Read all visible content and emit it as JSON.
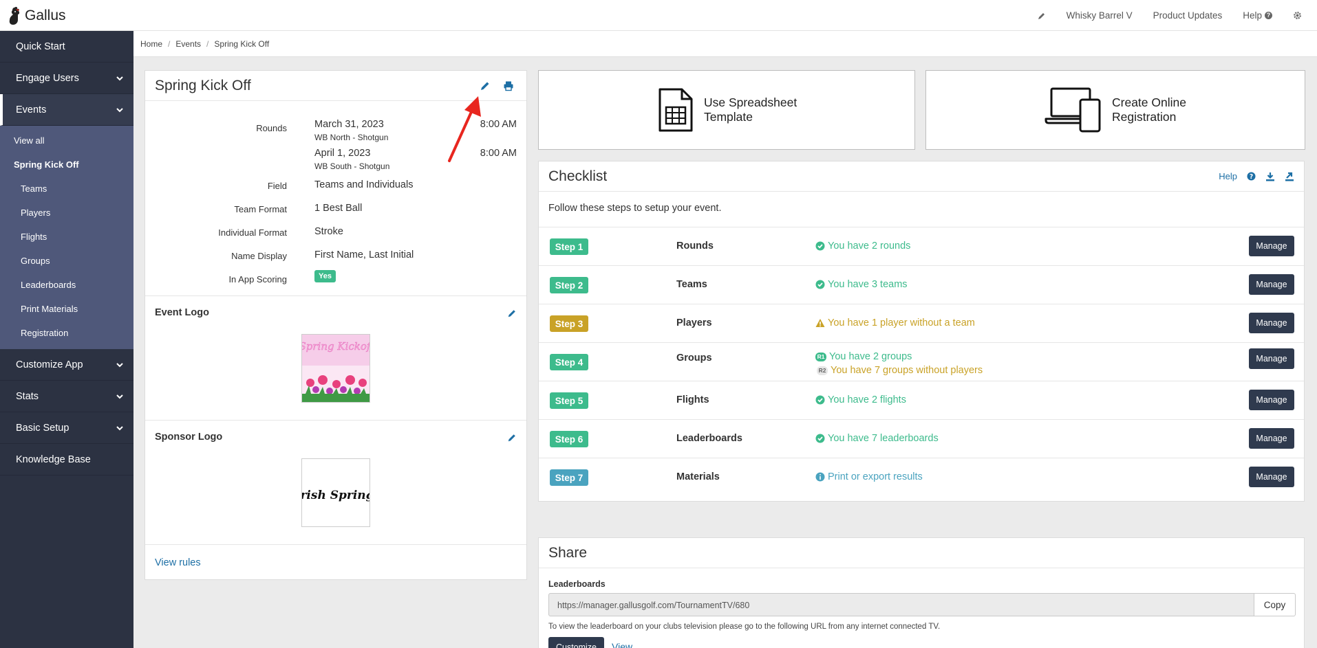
{
  "brand": {
    "name": "Gallus"
  },
  "topnav": {
    "club": "Whisky Barrel V",
    "updates": "Product Updates",
    "help": "Help"
  },
  "sidebar": {
    "quick_start": "Quick Start",
    "engage_users": "Engage Users",
    "events": "Events",
    "sub": {
      "view_all": "View all",
      "current_event": "Spring Kick Off",
      "items": [
        "Teams",
        "Players",
        "Flights",
        "Groups",
        "Leaderboards",
        "Print Materials",
        "Registration"
      ]
    },
    "customize_app": "Customize App",
    "stats": "Stats",
    "basic_setup": "Basic Setup",
    "knowledge_base": "Knowledge Base"
  },
  "breadcrumb": {
    "home": "Home",
    "events": "Events",
    "current": "Spring Kick Off"
  },
  "event": {
    "title": "Spring Kick Off",
    "labels": {
      "rounds": "Rounds",
      "field": "Field",
      "team_format": "Team Format",
      "individual_format": "Individual Format",
      "name_display": "Name Display",
      "in_app_scoring": "In App Scoring"
    },
    "rounds": [
      {
        "date": "March 31, 2023",
        "course": "WB North - Shotgun",
        "time": "8:00 AM"
      },
      {
        "date": "April 1, 2023",
        "course": "WB South - Shotgun",
        "time": "8:00 AM"
      }
    ],
    "field": "Teams and Individuals",
    "team_format": "1 Best Ball",
    "individual_format": "Stroke",
    "name_display": "First Name, Last Initial",
    "in_app_scoring": "Yes",
    "event_logo_title": "Event Logo",
    "event_logo_text": "Spring Kickoff",
    "sponsor_logo_title": "Sponsor Logo",
    "sponsor_logo_text": "Irish Spring.",
    "view_rules": "View rules"
  },
  "cards": {
    "spreadsheet": "Use Spreadsheet Template",
    "registration": "Create Online Registration"
  },
  "checklist": {
    "title": "Checklist",
    "help": "Help",
    "intro": "Follow these steps to setup your event.",
    "manage": "Manage",
    "steps": [
      {
        "badge": "Step 1",
        "name": "Rounds",
        "status": "You have 2 rounds",
        "color": "#3dbb8c"
      },
      {
        "badge": "Step 2",
        "name": "Teams",
        "status": "You have 3 teams",
        "color": "#3dbb8c"
      },
      {
        "badge": "Step 3",
        "name": "Players",
        "status": "You have 1 player without a team",
        "color": "#c9a227"
      },
      {
        "badge": "Step 4",
        "name": "Groups",
        "status": "You have 2 groups",
        "status2": "You have 7 groups without players",
        "tag1": "R1",
        "tag2": "R2",
        "color": "#3dbb8c"
      },
      {
        "badge": "Step 5",
        "name": "Flights",
        "status": "You have 2 flights",
        "color": "#3dbb8c"
      },
      {
        "badge": "Step 6",
        "name": "Leaderboards",
        "status": "You have 7 leaderboards",
        "color": "#3dbb8c"
      },
      {
        "badge": "Step 7",
        "name": "Materials",
        "status": "Print or export results",
        "color": "#4aa3bf"
      }
    ]
  },
  "share": {
    "title": "Share",
    "label": "Leaderboards",
    "url": "https://manager.gallusgolf.com/TournamentTV/680",
    "copy": "Copy",
    "help_text": "To view the leaderboard on your clubs television please go to the following URL from any internet connected TV.",
    "customize": "Customize",
    "view": "View"
  },
  "colors": {
    "sidebar": "#2c3242",
    "subnav": "#4f587a",
    "green": "#3dbb8c",
    "gold": "#c9a227",
    "teal": "#4aa3bf",
    "link": "#1d6fa5",
    "button": "#2f3a4e",
    "arrow": "#e8261f"
  }
}
